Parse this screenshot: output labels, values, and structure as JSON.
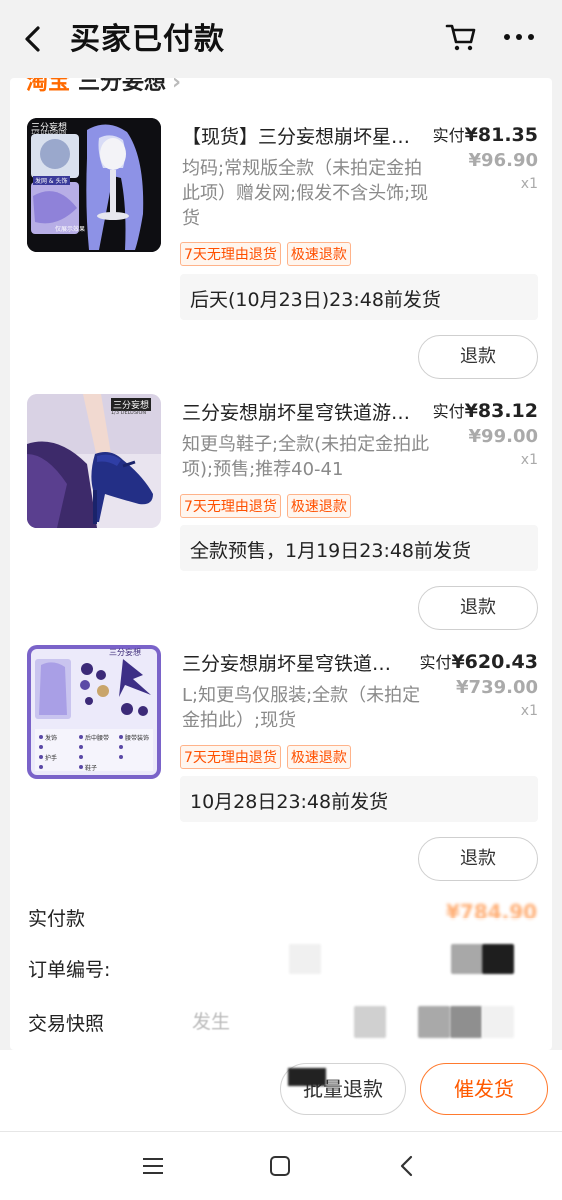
{
  "header": {
    "title": "买家已付款"
  },
  "shop": {
    "platform": "淘宝",
    "name": "三分妄想",
    "chevron": "›"
  },
  "items": [
    {
      "title": "【现货】三分妄想崩坏星…",
      "spec": "均码;常规版全款（未拍定金拍此项）赠发网;假发不含头饰;现货",
      "paid_label": "实付",
      "paid_price": "¥81.35",
      "orig_price": "¥96.90",
      "qty": "x1",
      "tags": [
        "7天无理由退货",
        "极速退款"
      ],
      "ship": "后天(10月23日)23:48前发货",
      "refund": "退款",
      "thumb_labels": [
        "三分妄想",
        "1/3 DELUSION",
        "发网 & 头饰",
        "仅展示效果"
      ]
    },
    {
      "title": "三分妄想崩坏星穹铁道游…",
      "spec": "知更鸟鞋子;全款(未拍定金拍此项);预售;推荐40-41",
      "paid_label": "实付",
      "paid_price": "¥83.12",
      "orig_price": "¥99.00",
      "qty": "x1",
      "tags": [
        "7天无理由退货",
        "极速退款"
      ],
      "ship": "全款预售，1月19日23:48前发货",
      "refund": "退款",
      "thumb_labels": [
        "三分妄想",
        "1/3 DELUSION"
      ]
    },
    {
      "title": "三分妄想崩坏星穹铁道…",
      "spec": "L;知更鸟仅服装;全款（未拍定金拍此）;现货",
      "paid_label": "实付",
      "paid_price": "¥620.43",
      "orig_price": "¥739.00",
      "qty": "x1",
      "tags": [
        "7天无理由退货",
        "极速退款"
      ],
      "ship": "10月28日23:48前发货",
      "refund": "退款",
      "thumb_labels": [
        "三分妄想",
        "发饰",
        "后中腰带",
        "连裤袜",
        "腰带装饰",
        "护手",
        "后腰饰",
        "领子",
        "鞋子"
      ]
    }
  ],
  "info": {
    "paid_label": "实付款",
    "paid_value": "¥784.90",
    "order_label": "订单编号:",
    "snapshot_label": "交易快照",
    "snapshot_value": "发生"
  },
  "bottom": {
    "batch_refund": "批量退款",
    "urge_ship": "催发货"
  },
  "colors": {
    "accent": "#ff5000",
    "price_text": "#222222"
  },
  "icons": [
    "back-icon",
    "cart-icon",
    "more-icon",
    "menu-icon",
    "home-icon",
    "back-nav-icon"
  ]
}
